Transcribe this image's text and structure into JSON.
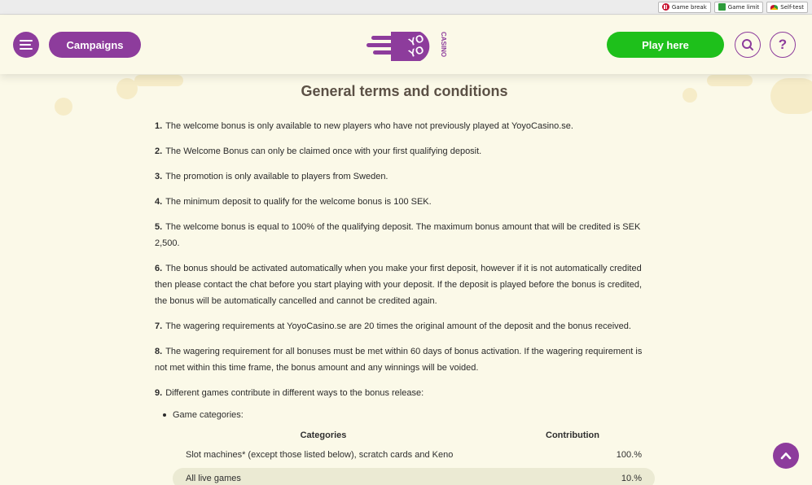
{
  "rg_bar": {
    "game_break": "Game break",
    "game_limit": "Game limit",
    "self_test": "Self-test"
  },
  "header": {
    "campaigns_label": "Campaigns",
    "play_label": "Play here",
    "help_label": "?",
    "logo_text": {
      "yo1": "YO",
      "yo2": "YO",
      "casino": "CASINO"
    }
  },
  "main": {
    "title": "General terms and conditions",
    "terms": [
      {
        "num": "1.",
        "text": "The welcome bonus is only available to new players who have not previously played at YoyoCasino.se."
      },
      {
        "num": "2.",
        "text": "The Welcome Bonus can only be claimed once with your first qualifying deposit."
      },
      {
        "num": "3.",
        "text": "The promotion is only available to players from Sweden."
      },
      {
        "num": "4.",
        "text": "The minimum deposit to qualify for the welcome bonus is 100 SEK."
      },
      {
        "num": "5.",
        "text": "The welcome bonus is equal to 100% of the qualifying deposit. The maximum bonus amount that will be credited is SEK 2,500."
      },
      {
        "num": "6.",
        "text": "The bonus should be activated automatically when you make your first deposit, however if it is not automatically credited then please contact the chat before you start playing with your deposit. If the deposit is played before the bonus is credited, the bonus will be automatically cancelled and cannot be credited again."
      },
      {
        "num": "7.",
        "text": "The wagering requirements at YoyoCasino.se are 20 times the original amount of the deposit and the bonus received."
      },
      {
        "num": "8.",
        "text": "The wagering requirement for all bonuses must be met within 60 days of bonus activation. If the wagering requirement is not met within this time frame, the bonus amount and any winnings will be voided."
      },
      {
        "num": "9.",
        "text": "Different games contribute in different ways to the bonus release:"
      }
    ],
    "bullet": "Game categories:",
    "table": {
      "headers": [
        "Categories",
        "Contribution"
      ],
      "rows": [
        {
          "category": "Slot machines* (except those listed below), scratch cards and Keno",
          "contribution": "100.%"
        },
        {
          "category": "All live games",
          "contribution": "10.%"
        }
      ]
    }
  },
  "colors": {
    "brand_purple": "#8d3c9c",
    "play_green": "#1ec01b",
    "background": "#fbf9e8"
  }
}
